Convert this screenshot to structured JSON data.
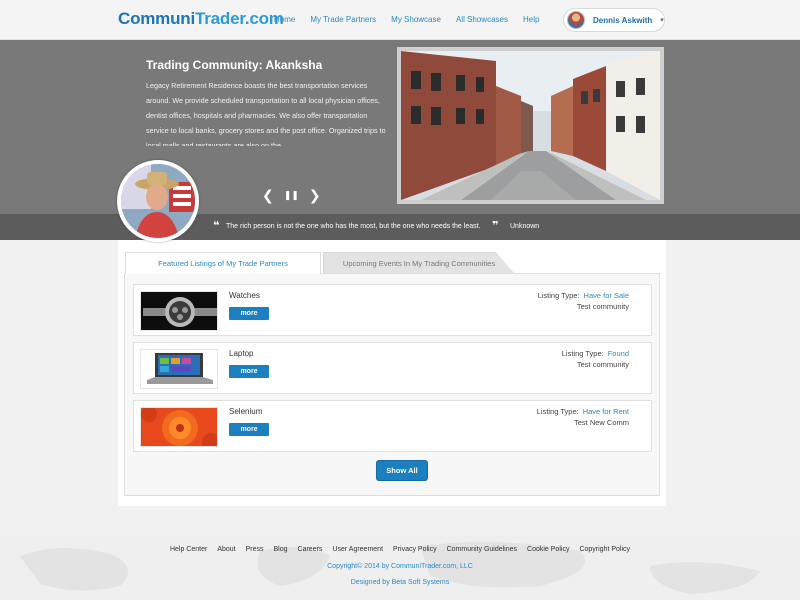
{
  "brand": {
    "part1": "Communi",
    "part2": "Trader.com"
  },
  "nav": [
    {
      "label": "Home"
    },
    {
      "label": "My Trade Partners"
    },
    {
      "label": "My Showcase"
    },
    {
      "label": "All Showcases"
    },
    {
      "label": "Help"
    }
  ],
  "user": {
    "name": "Dennis Askwith"
  },
  "hero": {
    "title": "Trading Community: Akanksha",
    "description": "Legacy Retirement Residence boasts the best transportation services around. We provide scheduled transportation to all local physician offices, dentist offices, hospitals and pharmacies. We also offer transportation service to local banks, grocery stores and the post office. Organized trips to local malls and restaurants are also on the"
  },
  "quote": {
    "text": "The rich person is not the one who has the most, but the one who needs the least.",
    "author": "Unknown"
  },
  "tabs": {
    "active": "Featured Listings of My Trade Partners",
    "inactive": "Upcoming Events In My Trading Communities"
  },
  "listings": [
    {
      "title": "Watches",
      "more_label": "more",
      "type_label": "Listing Type:",
      "type_value": "Have for Sale",
      "community": "Test community"
    },
    {
      "title": "Laptop",
      "more_label": "more",
      "type_label": "Listing Type:",
      "type_value": "Found",
      "community": "Test community"
    },
    {
      "title": "Selenium",
      "more_label": "more",
      "type_label": "Listing Type:",
      "type_value": "Have for Rent",
      "community": "Test New Comm"
    }
  ],
  "show_all_label": "Show All",
  "footer": {
    "links": [
      {
        "label": "Help Center"
      },
      {
        "label": "About"
      },
      {
        "label": "Press"
      },
      {
        "label": "Blog"
      },
      {
        "label": "Careers"
      },
      {
        "label": "User Agreement"
      },
      {
        "label": "Privacy Policy"
      },
      {
        "label": "Community Guidelines"
      },
      {
        "label": "Cookie Policy"
      },
      {
        "label": "Copyright Policy"
      }
    ],
    "copyright": "Copyright© 2014 by CommuniTrader.com, LLC",
    "designed_by": "Designed by Beta Soft Systems"
  },
  "colors": {
    "accent": "#1c7fbf",
    "link": "#2a8ac6",
    "hero_bg": "#797979",
    "quote_bg": "#5c5c5c"
  }
}
